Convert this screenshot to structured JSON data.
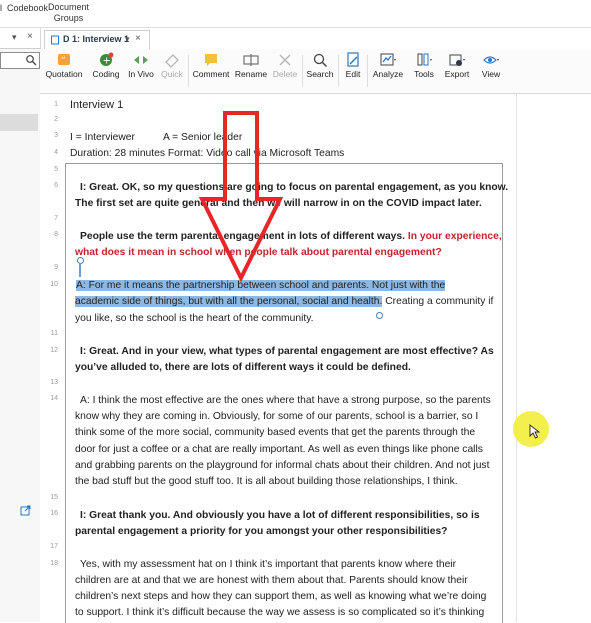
{
  "top": {
    "codebook": "Codebook",
    "document_groups_1": "Document",
    "document_groups_2": "Groups",
    "left_marker": "l"
  },
  "doc_tab": {
    "label": "D 1: Interview 1",
    "close": "×",
    "menu": "▾"
  },
  "left_tab": {
    "menu": "▾",
    "close": "×"
  },
  "toolbar": {
    "quotation": "Quotation",
    "coding": "Coding",
    "in_vivo": "In Vivo",
    "quick": "Quick",
    "comment": "Comment",
    "rename": "Rename",
    "delete": "Delete",
    "search": "Search",
    "edit": "Edit",
    "analyze": "Analyze",
    "tools": "Tools",
    "export": "Export",
    "view": "View"
  },
  "lines": {
    "n1": "1",
    "n2": "2",
    "n3": "3",
    "n4": "4",
    "n5": "5",
    "n6": "6",
    "n7": "7",
    "n8": "8",
    "n9": "9",
    "n10": "10",
    "n11": "11",
    "n12": "12",
    "n13": "13",
    "n14": "14",
    "n15": "15",
    "n16": "16",
    "n17": "17",
    "n18": "18"
  },
  "document": {
    "title": "Interview 1",
    "legend": "I = Interviewer          A = Senior leader",
    "duration": "Duration: 28 minutes  Format: Video call via Microsoft Teams",
    "p6a": "I: Great. OK, so my questions are going to focus on parental engagement, as you know.",
    "p6b": "The first set are quite general and then we will narrow in on the COVID impact later.",
    "p8a_black": "People use the term parental engagement in lots of different ways. ",
    "p8a_red": "In your experience,",
    "p8b_red": "what does it mean in school when people talk about parental engagement?",
    "p10a_hl": "A: For me it means the partnership between school and parents. Not just with the",
    "p10b_hl": "academic side of things, but with all the personal, social and health.",
    "p10b_rest": " Creating a community if",
    "p10c": "you like, so the school is the heart of the community.",
    "p12a": "I: Great. And in your view, what types of parental engagement are most effective? As",
    "p12b": "you’ve alluded to, there are lots of different ways it could be defined.",
    "p14a": "A: I think the most effective are the ones where that have a strong purpose, so the parents",
    "p14b": "know why they are coming in. Obviously, for some of our parents, school is a barrier, so I",
    "p14c": "think some of the more social, community based events that get the parents through the",
    "p14d": "door for just a coffee or a chat are really important. As well as even things like phone calls",
    "p14e": "and grabbing parents on the playground for informal chats about their children. And not just",
    "p14f": "the bad stuff but the good stuff too. It is all about building those relationships, I think.",
    "p16a": "I: Great thank you. And obviously you have a lot of different responsibilities, so is",
    "p16b": "parental engagement a priority for you amongst your other responsibilities?",
    "p18a": "Yes, with my assessment hat on I think it’s important that parents know where their",
    "p18b": "children are at and that we are honest with them about that. Parents should know their",
    "p18c": "children’s next steps and how they can support them, as well as knowing what we’re doing",
    "p18d": "to support. I think it’s difficult because the way we assess is so complicated so it’s thinking"
  },
  "colors": {
    "accent": "#2b78c5",
    "highlight": "#8cb8e2",
    "red_text": "#c0262d",
    "arrow": "#e8262a",
    "cursor": "#f2ef3f"
  }
}
